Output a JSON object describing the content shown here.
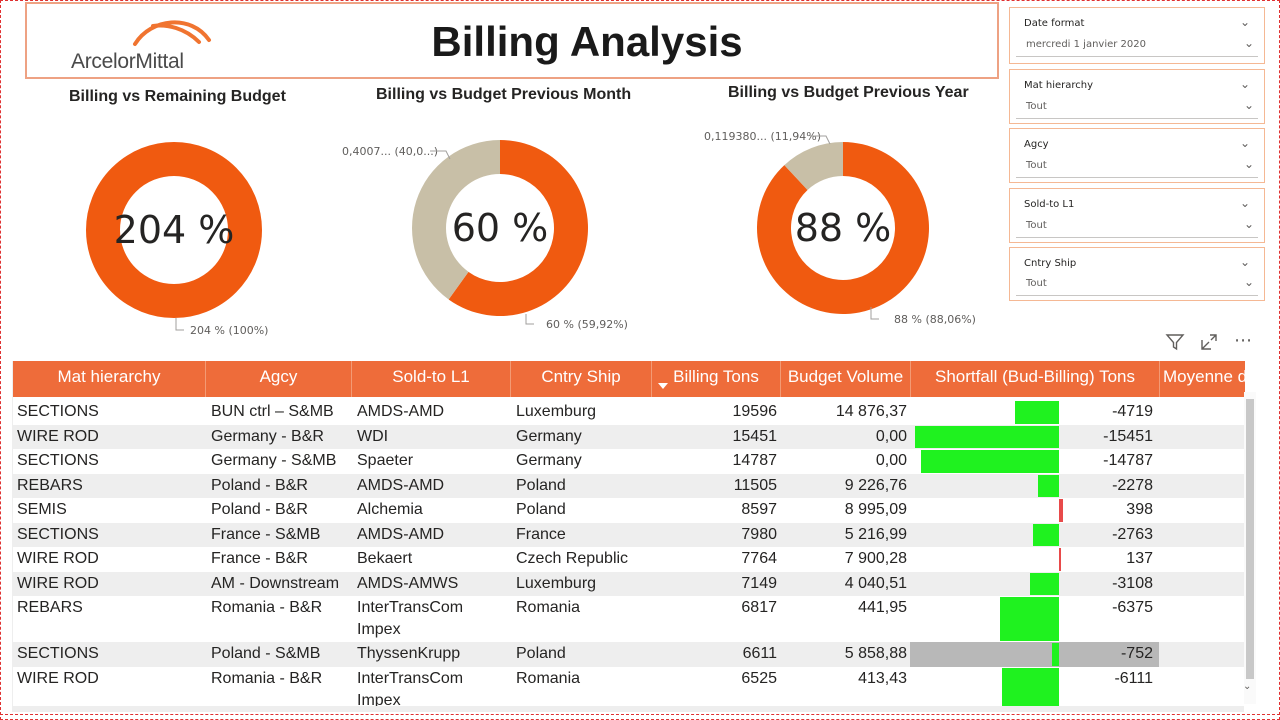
{
  "header": {
    "logo_text": "ArcelorMittal",
    "title": "Billing Analysis",
    "brand_color": "#ee6c3a"
  },
  "charts": {
    "c1": {
      "title": "Billing vs Remaining Budget",
      "center": "204 %",
      "label_main": "204 % (100%)"
    },
    "c2": {
      "title": "Billing vs Budget Previous Month",
      "center": "60 %",
      "label_main": "60 % (59,92%)",
      "label_rest": "0,4007... (40,0...)"
    },
    "c3": {
      "title": "Billing vs Budget Previous Year",
      "center": "88 %",
      "label_main": "88 % (88,06%)",
      "label_rest": "0,119380... (11,94%)"
    }
  },
  "chart_data": [
    {
      "type": "pie",
      "title": "Billing vs Remaining Budget",
      "center_label": "204 %",
      "slices": [
        {
          "label": "204 %",
          "share": 100
        }
      ],
      "colors": [
        "#f05a10"
      ]
    },
    {
      "type": "pie",
      "title": "Billing vs Budget Previous Month",
      "center_label": "60 %",
      "slices": [
        {
          "label": "60 %",
          "share": 59.92
        },
        {
          "label": "0,4007...",
          "share": 40.08
        }
      ],
      "colors": [
        "#f05a10",
        "#c8bfa7"
      ]
    },
    {
      "type": "pie",
      "title": "Billing vs Budget Previous Year",
      "center_label": "88 %",
      "slices": [
        {
          "label": "88 %",
          "share": 88.06
        },
        {
          "label": "0,119380...",
          "share": 11.94
        }
      ],
      "colors": [
        "#f05a10",
        "#c8bfa7"
      ]
    }
  ],
  "slicers": [
    {
      "header": "Date format",
      "value": "mercredi 1 janvier 2020"
    },
    {
      "header": "Mat hierarchy",
      "value": "Tout"
    },
    {
      "header": "Agcy",
      "value": "Tout"
    },
    {
      "header": "Sold-to L1",
      "value": "Tout"
    },
    {
      "header": "Cntry Ship",
      "value": "Tout"
    }
  ],
  "toolbar": {
    "filter_icon": "filter-icon",
    "focus_icon": "focus-mode-icon",
    "more_icon": "more-options-icon",
    "more_glyph": "⋯"
  },
  "table": {
    "columns": [
      "Mat hierarchy",
      "Agcy",
      "Sold-to L1",
      "Cntry Ship",
      "Billing Tons",
      "Budget Volume",
      "Shortfall (Bud-Billing) Tons",
      "Moyenne d"
    ],
    "rows": [
      {
        "mat": "SECTIONS",
        "agcy": "BUN ctrl – S&MB",
        "sold": "AMDS-AMD",
        "sold2": "",
        "cntry": "Luxemburg",
        "billing": "19596",
        "budget": "14 876,37",
        "shortfall": "-4719",
        "sf": -4719
      },
      {
        "mat": "WIRE ROD",
        "agcy": "Germany - B&R",
        "sold": "WDI",
        "sold2": "",
        "cntry": "Germany",
        "billing": "15451",
        "budget": "0,00",
        "shortfall": "-15451",
        "sf": -15451
      },
      {
        "mat": "SECTIONS",
        "agcy": "Germany - S&MB",
        "sold": "Spaeter",
        "sold2": "",
        "cntry": "Germany",
        "billing": "14787",
        "budget": "0,00",
        "shortfall": "-14787",
        "sf": -14787
      },
      {
        "mat": "REBARS",
        "agcy": "Poland - B&R",
        "sold": "AMDS-AMD",
        "sold2": "",
        "cntry": "Poland",
        "billing": "11505",
        "budget": "9 226,76",
        "shortfall": "-2278",
        "sf": -2278
      },
      {
        "mat": "SEMIS",
        "agcy": "Poland - B&R",
        "sold": "Alchemia",
        "sold2": "",
        "cntry": "Poland",
        "billing": "8597",
        "budget": "8 995,09",
        "shortfall": "398",
        "sf": 398
      },
      {
        "mat": "SECTIONS",
        "agcy": "France - S&MB",
        "sold": "AMDS-AMD",
        "sold2": "",
        "cntry": "France",
        "billing": "7980",
        "budget": "5 216,99",
        "shortfall": "-2763",
        "sf": -2763
      },
      {
        "mat": "WIRE ROD",
        "agcy": "France - B&R",
        "sold": "Bekaert",
        "sold2": "",
        "cntry": "Czech Republic",
        "billing": "7764",
        "budget": "7 900,28",
        "shortfall": "137",
        "sf": 137
      },
      {
        "mat": "WIRE ROD",
        "agcy": "AM - Downstream",
        "sold": "AMDS-AMWS",
        "sold2": "",
        "cntry": "Luxemburg",
        "billing": "7149",
        "budget": "4 040,51",
        "shortfall": "-3108",
        "sf": -3108
      },
      {
        "mat": "REBARS",
        "agcy": "Romania - B&R",
        "sold": "InterTransCom",
        "sold2": "Impex",
        "cntry": "Romania",
        "billing": "6817",
        "budget": "441,95",
        "shortfall": "-6375",
        "sf": -6375
      },
      {
        "mat": "SECTIONS",
        "agcy": "Poland - S&MB",
        "sold": "ThyssenKrupp",
        "sold2": "",
        "cntry": "Poland",
        "billing": "6611",
        "budget": "5 858,88",
        "shortfall": "-752",
        "sf": -752,
        "selected": true
      },
      {
        "mat": "WIRE ROD",
        "agcy": "Romania - B&R",
        "sold": "InterTransCom",
        "sold2": "Impex",
        "cntry": "Romania",
        "billing": "6525",
        "budget": "413,43",
        "shortfall": "-6111",
        "sf": -6111
      }
    ]
  }
}
